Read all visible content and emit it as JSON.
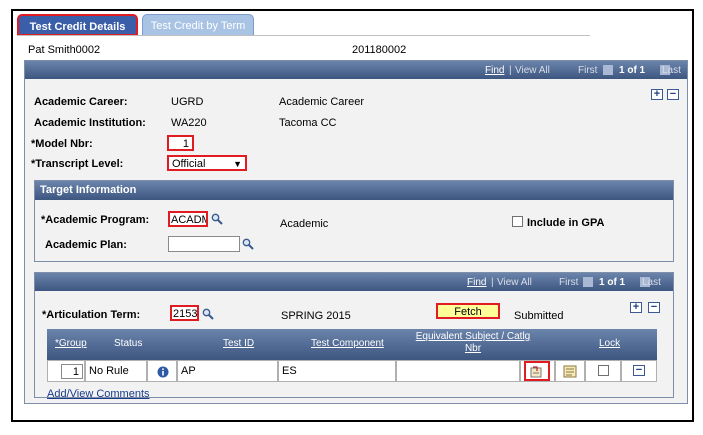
{
  "tabs": [
    {
      "label": "Test Credit Details"
    },
    {
      "label": "Test Credit by Term"
    }
  ],
  "header": {
    "name": "Pat Smith0002",
    "id": "201180002"
  },
  "main_nav": {
    "find": "Find",
    "view_all": "View All",
    "first": "First",
    "range": "1 of 1",
    "last": "Last"
  },
  "fields": {
    "academic_career_label": "Academic Career:",
    "academic_career_value": "UGRD",
    "academic_career_desc": "Academic Career",
    "academic_institution_label": "Academic Institution:",
    "academic_institution_value": "WA220",
    "academic_institution_desc": "Tacoma CC",
    "model_nbr_label": "*Model Nbr:",
    "model_nbr_value": "1",
    "transcript_level_label": "*Transcript Level:",
    "transcript_level_value": "Official"
  },
  "target": {
    "title": "Target Information",
    "academic_program_label": "*Academic Program:",
    "academic_program_value": "ACADM",
    "academic_program_desc": "Academic",
    "include_gpa_label": "Include in GPA",
    "academic_plan_label": "Academic Plan:",
    "academic_plan_value": ""
  },
  "articulation": {
    "nav": {
      "find": "Find",
      "view_all": "View All",
      "first": "First",
      "range": "1 of 1",
      "last": "Last"
    },
    "term_label": "*Articulation Term:",
    "term_value": "2153",
    "term_desc": "SPRING 2015",
    "fetch_label": "Fetch",
    "status": "Submitted"
  },
  "grid": {
    "columns": [
      "*Group",
      "Status",
      "Test ID",
      "Test Component",
      "Equivalent Subject / Catlg Nbr",
      "Lock"
    ],
    "rows": [
      {
        "group": "1",
        "status": "No Rule",
        "test_id": "AP",
        "test_component": "ES",
        "equivalent": ""
      }
    ]
  },
  "comments_link": "Add/View Comments",
  "colors": {
    "header_blue": "#4f6a93",
    "highlight_red": "#e01b22",
    "fetch_yellow": "#ffff99"
  }
}
